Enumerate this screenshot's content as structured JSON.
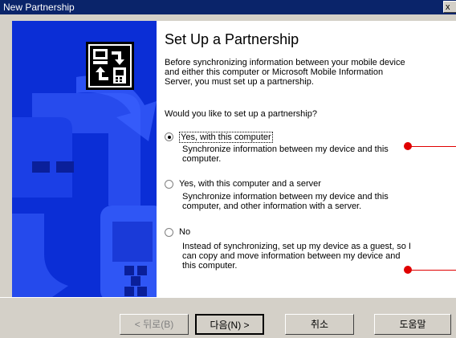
{
  "window": {
    "title": "New Partnership",
    "close_label": "x"
  },
  "page": {
    "heading": "Set Up a Partnership",
    "intro": "Before synchronizing information between your mobile device and either this computer or Microsoft Mobile Information Server, you must set up a partnership.",
    "question": "Would you like to set up a partnership?"
  },
  "options": [
    {
      "label": "Yes, with this computer",
      "description": "Synchronize information between my device and this computer.",
      "selected": true
    },
    {
      "label": "Yes, with this computer and a server",
      "description": "Synchronize information between my device and this computer, and other information with a server.",
      "selected": false
    },
    {
      "label": "No",
      "description": "Instead of synchronizing, set up my device as a guest, so I can copy and move information between my device and this computer.",
      "selected": false
    }
  ],
  "buttons": {
    "back": "< 뒤로(B)",
    "next": "다음(N) >",
    "cancel": "취소",
    "help": "도움말"
  },
  "colors": {
    "banner": "#0b2ed6",
    "title_bar": "#0a246a",
    "callout": "#e00000"
  }
}
